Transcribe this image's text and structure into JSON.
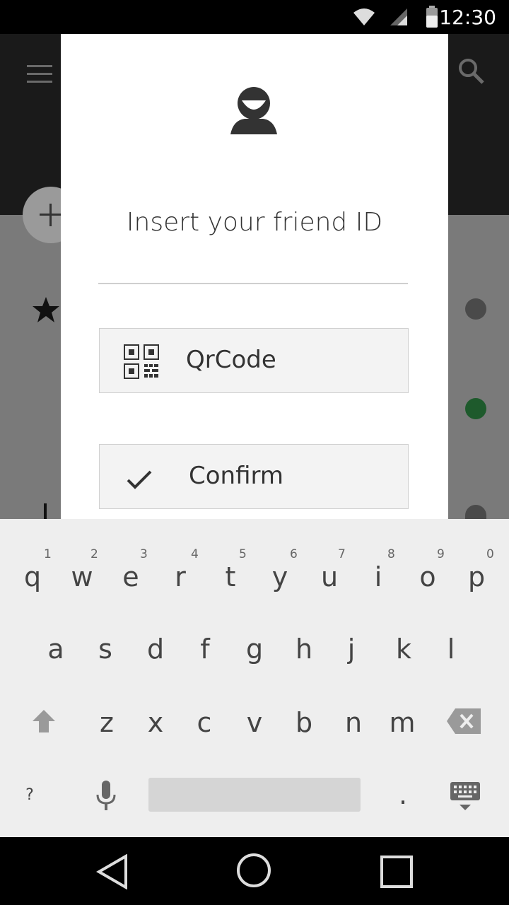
{
  "status_bar": {
    "time": "12:30",
    "icons": [
      "wifi-icon",
      "signal-icon",
      "battery-icon"
    ]
  },
  "app_bar": {
    "icons": [
      "menu-icon",
      "search-icon"
    ]
  },
  "background_list": {
    "icons": [
      "add-icon",
      "star-icon"
    ],
    "status_dot_colors": [
      "#4a4a4a",
      "#1e5a2c",
      "#4a4a4a"
    ]
  },
  "dialog": {
    "icon": "person-icon",
    "title": "Insert your friend ID",
    "input": {
      "value": "",
      "placeholder": ""
    },
    "qrcode_button": {
      "label": "QrCode",
      "icon": "qrcode-icon"
    },
    "confirm_button": {
      "label": "Confirm",
      "icon": "check-icon"
    }
  },
  "keyboard": {
    "row1": [
      "q",
      "w",
      "e",
      "r",
      "t",
      "y",
      "u",
      "i",
      "o",
      "p"
    ],
    "row1_hints": [
      "1",
      "2",
      "3",
      "4",
      "5",
      "6",
      "7",
      "8",
      "9",
      "0"
    ],
    "row2": [
      "a",
      "s",
      "d",
      "f",
      "g",
      "h",
      "j",
      "k",
      "l"
    ],
    "row3": [
      "z",
      "x",
      "c",
      "v",
      "b",
      "n",
      "m"
    ],
    "symbols_key": "?",
    "period_key": ".",
    "icons": [
      "shift-icon",
      "backspace-icon",
      "mic-icon",
      "keyboard-hide-icon"
    ]
  },
  "nav_bar": {
    "icons": [
      "back-icon",
      "home-icon",
      "recents-icon"
    ]
  }
}
